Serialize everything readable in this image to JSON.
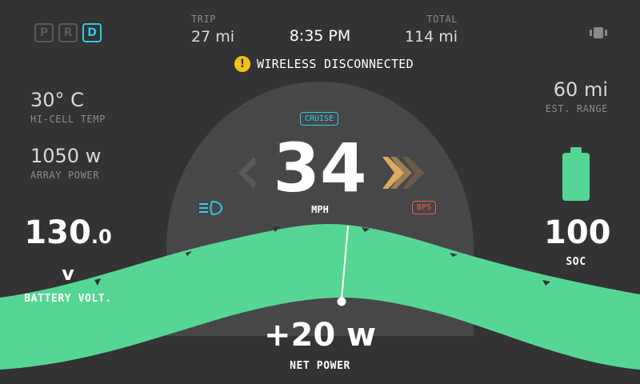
{
  "gears": [
    {
      "label": "P",
      "active": false
    },
    {
      "label": "R",
      "active": false
    },
    {
      "label": "D",
      "active": true
    }
  ],
  "trip": {
    "label": "TRIP",
    "value": "27 mi"
  },
  "clock": "8:35 PM",
  "total": {
    "label": "TOTAL",
    "value": "114 mi"
  },
  "warning": {
    "icon": "!",
    "text": "WIRELESS DISCONNECTED"
  },
  "hi_cell_temp": {
    "value": "30° C",
    "label": "HI-CELL TEMP"
  },
  "array_power": {
    "value": "1050 w",
    "label": "ARRAY POWER"
  },
  "battery_volt": {
    "value_int": "130",
    "value_dec": ".0 v",
    "label": "BATTERY VOLT."
  },
  "est_range": {
    "value": "60 mi",
    "label": "EST. RANGE"
  },
  "soc": {
    "value": "100",
    "label": "SOC",
    "percent": 100
  },
  "speed": {
    "value": "34",
    "unit": "MPH"
  },
  "cruise_label": "CRUISE",
  "bps_label": "BPS",
  "net_power": {
    "value": "+20 w",
    "label": "NET POWER"
  },
  "colors": {
    "background": "#333333",
    "gauge": "#484848",
    "green": "#56d694",
    "cyan": "#2ec9e6",
    "warning": "#f2c315",
    "red": "#e8604c",
    "arrow_on": "#e0a860"
  },
  "icons": {
    "vibration": "vibration-icon",
    "headlight": "headlight-icon",
    "left_turn": "left-turn-arrow-icon",
    "right_turn": "right-turn-arrows-icon"
  }
}
